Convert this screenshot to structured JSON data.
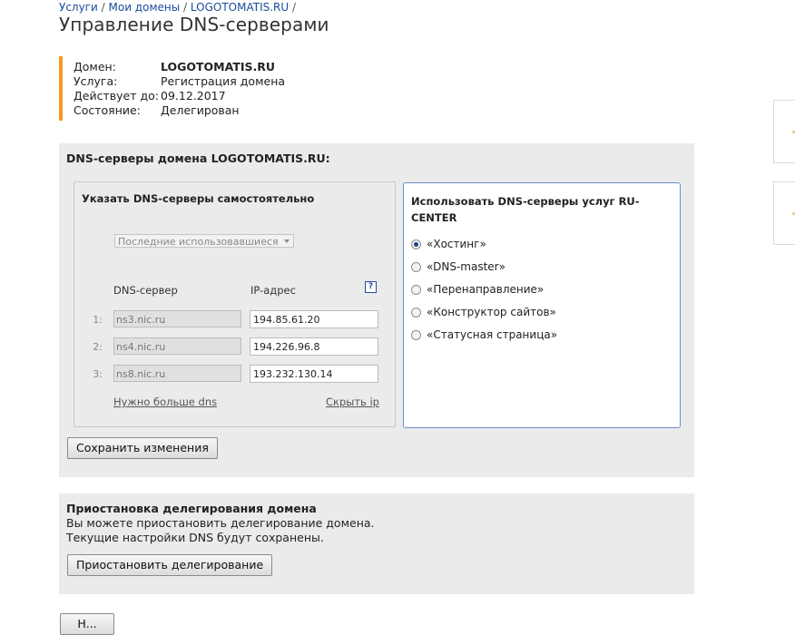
{
  "breadcrumb": {
    "items": [
      "Услуги",
      "Мои домены",
      "LOGOTOMATIS.RU"
    ],
    "separator": "/"
  },
  "page_title": "Управление DNS-серверами",
  "domain_info": {
    "rows": [
      {
        "label": "Домен:",
        "value": "LOGOTOMATIS.RU"
      },
      {
        "label": "Услуга:",
        "value": "Регистрация домена"
      },
      {
        "label": "Действует до:",
        "value": "09.12.2017"
      },
      {
        "label": "Состояние:",
        "value": "Делегирован"
      }
    ],
    "accent_color": "#f29b1d"
  },
  "dns_panel": {
    "title": "DNS-серверы домена LOGOTOMATIS.RU:",
    "custom": {
      "title": "Указать DNS-серверы самостоятельно",
      "preset_select": "Последние использовавшиеся",
      "col_server": "DNS-сервер",
      "col_ip": "IP-адрес",
      "help_icon": "?",
      "rows": [
        {
          "num": "1:",
          "server": "ns3.nic.ru",
          "ip": "194.85.61.20"
        },
        {
          "num": "2:",
          "server": "ns4.nic.ru",
          "ip": "194.226.96.8"
        },
        {
          "num": "3:",
          "server": "ns8.nic.ru",
          "ip": "193.232.130.14"
        }
      ],
      "more_link": "Нужно больше dns",
      "hide_ip_link": "Скрыть ip"
    },
    "service": {
      "title": "Использовать DNS-серверы услуг RU-CENTER",
      "options": [
        {
          "label": "«Хостинг»",
          "checked": true
        },
        {
          "label": "«DNS-master»",
          "checked": false
        },
        {
          "label": "«Перенаправление»",
          "checked": false
        },
        {
          "label": "«Конструктор сайтов»",
          "checked": false
        },
        {
          "label": "«Статусная страница»",
          "checked": false
        }
      ],
      "border_color": "#6a8fc4"
    },
    "save_button": "Сохранить изменения"
  },
  "suspend_panel": {
    "title": "Приостановка делегирования домена",
    "line1": "Вы можете приостановить делегирование домена.",
    "line2": "Текущие настройки DNS будут сохранены.",
    "button": "Приостановить делегирование"
  },
  "bottom_button": "Н..."
}
